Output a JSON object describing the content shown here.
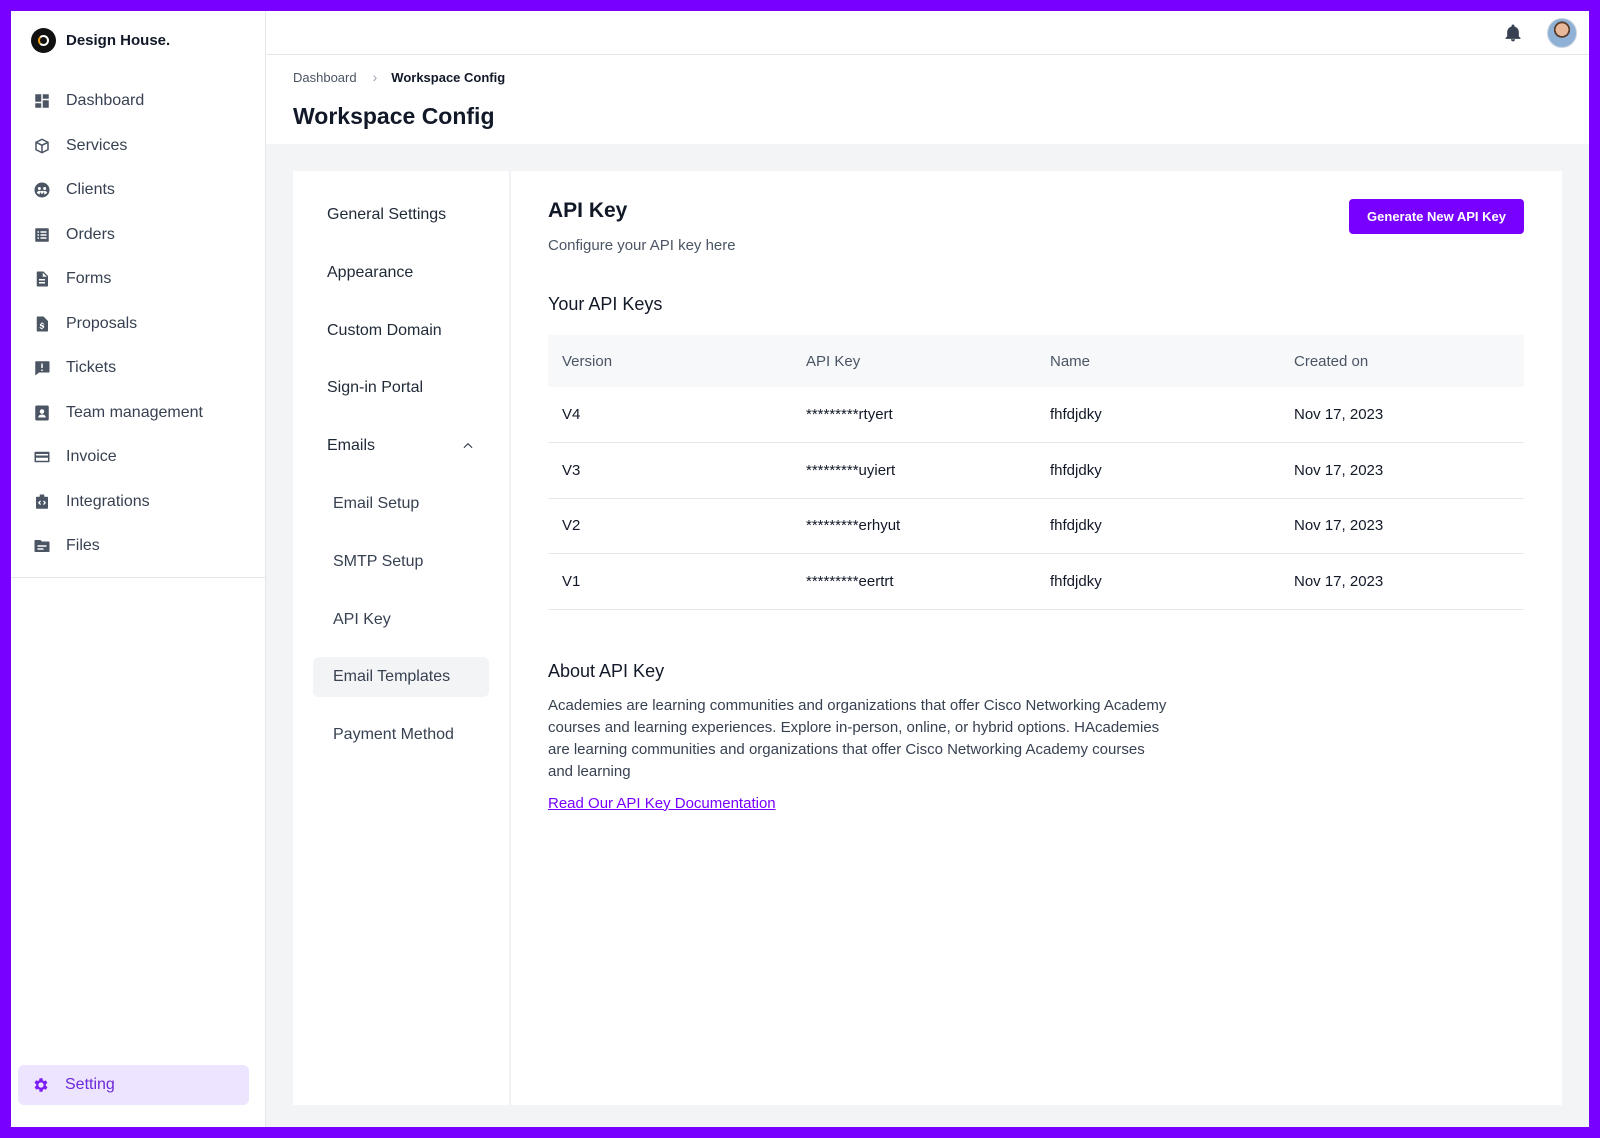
{
  "brand": {
    "name": "Design House."
  },
  "sidebar": {
    "items": [
      {
        "label": "Dashboard",
        "icon": "dashboard-icon"
      },
      {
        "label": "Services",
        "icon": "box-icon"
      },
      {
        "label": "Clients",
        "icon": "users-icon"
      },
      {
        "label": "Orders",
        "icon": "list-icon"
      },
      {
        "label": "Forms",
        "icon": "document-icon"
      },
      {
        "label": "Proposals",
        "icon": "dollar-document-icon"
      },
      {
        "label": "Tickets",
        "icon": "alert-message-icon"
      },
      {
        "label": "Team management",
        "icon": "contact-card-icon"
      },
      {
        "label": "Invoice",
        "icon": "credit-card-icon"
      },
      {
        "label": "Integrations",
        "icon": "code-box-icon"
      },
      {
        "label": "Files",
        "icon": "folder-icon"
      }
    ],
    "setting": {
      "label": "Setting",
      "icon": "gear-icon",
      "accent": "#7700ff"
    }
  },
  "breadcrumb": {
    "root": "Dashboard",
    "current": "Workspace Config"
  },
  "page": {
    "title": "Workspace Config"
  },
  "settings_nav": {
    "items": [
      {
        "label": "General Settings"
      },
      {
        "label": "Appearance"
      },
      {
        "label": "Custom Domain"
      },
      {
        "label": "Sign-in Portal"
      },
      {
        "label": "Emails"
      },
      {
        "label": "Email Setup"
      },
      {
        "label": "SMTP Setup"
      },
      {
        "label": "API Key"
      },
      {
        "label": "Email Templates"
      },
      {
        "label": "Payment Method"
      }
    ]
  },
  "api": {
    "title": "API Key",
    "subtitle": "Configure your API key here",
    "generate_label": "Generate New API Key",
    "keys_title": "Your API Keys",
    "columns": [
      "Version",
      "API Key",
      "Name",
      "Created on"
    ],
    "rows": [
      [
        "V4",
        "*********rtyert",
        "fhfdjdky",
        "Nov 17, 2023"
      ],
      [
        "V3",
        "*********uyiert",
        "fhfdjdky",
        "Nov 17, 2023"
      ],
      [
        "V2",
        "*********erhyut",
        "fhfdjdky",
        "Nov 17, 2023"
      ],
      [
        "V1",
        "*********eertrt",
        "fhfdjdky",
        "Nov 17, 2023"
      ]
    ],
    "about_title": "About API Key",
    "about_text": "Academies are learning communities and organizations that offer Cisco Networking Academy courses and learning experiences. Explore in-person, online, or hybrid options. HAcademies are learning communities and organizations that offer Cisco Networking Academy courses and learning",
    "doc_link": "Read Our API Key Documentation"
  },
  "colors": {
    "accent": "#7700ff",
    "frame": "#7700ff",
    "active_bg": "#ede4ff"
  }
}
